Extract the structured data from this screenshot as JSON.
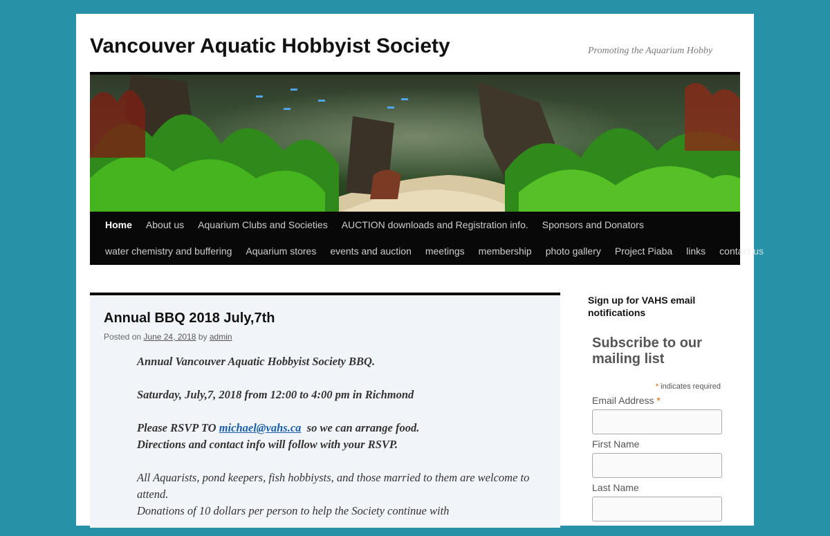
{
  "site": {
    "title": "Vancouver Aquatic Hobbyist Society",
    "description": "Promoting the Aquarium Hobby"
  },
  "nav": {
    "row1": [
      "Home",
      "About us",
      "Aquarium Clubs and Societies",
      "AUCTION downloads and Registration info.",
      "Sponsors and Donators"
    ],
    "row2": [
      "water chemistry and buffering",
      "Aquarium stores",
      "events and auction",
      "meetings",
      "membership",
      "photo gallery",
      "Project Piaba",
      "links",
      "contact us"
    ]
  },
  "post": {
    "title": "Annual BBQ 2018 July,7th",
    "meta_prefix": "Posted on",
    "date": "June 24, 2018",
    "meta_by": "by",
    "author": "admin",
    "p1": "Annual Vancouver Aquatic Hobbyist Society BBQ.",
    "p2": "Saturday, July,7, 2018 from 12:00 to 4:00 pm in Richmond",
    "p3_pre": "Please RSVP TO ",
    "p3_email": "michael@vahs.ca",
    "p3_post": "  so we can arrange food.",
    "p3_line2": "Directions and contact info will follow with your RSVP.",
    "p4": "All Aquarists, pond keepers,  fish hobbiysts, and those married to them are welcome to attend.",
    "p5": "Donations of 10 dollars per person  to help the Society  continue with"
  },
  "sidebar": {
    "widget_title": "Sign up for VAHS email notifications",
    "mc_title": "Subscribe to our mailing list",
    "required_note": "indicates required",
    "email_label": "Email Address",
    "first_name_label": "First Name",
    "last_name_label": "Last Name"
  },
  "colors": {
    "background": "#2691a7",
    "nav_background": "#080808",
    "article_background": "#f1f5f9"
  }
}
